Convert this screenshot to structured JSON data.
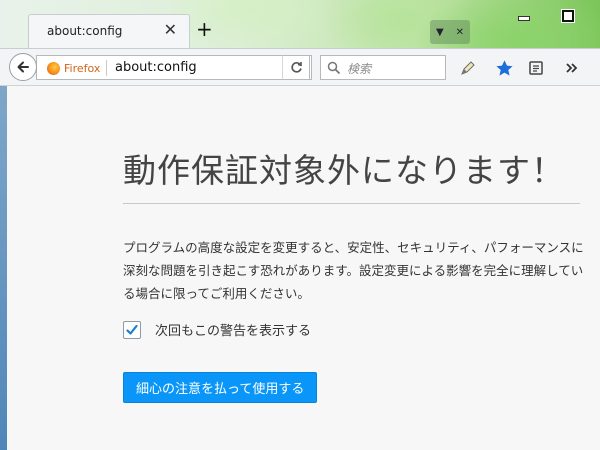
{
  "tab": {
    "title": "about:config",
    "close_glyph": "✕",
    "new_tab_glyph": "+"
  },
  "window_controls": [
    "minimize-icon",
    "maximize-icon"
  ],
  "navbar": {
    "identity_label": "Firefox",
    "url": "about:config",
    "search_placeholder": "検索",
    "icons": [
      "back-arrow-icon",
      "firefox-logo-icon",
      "reload-icon",
      "search-icon",
      "pencil-icon",
      "bookmark-star-icon",
      "reading-list-icon",
      "overflow-chevron-icon"
    ]
  },
  "page": {
    "title": "動作保証対象外になります！",
    "warning_text": "プログラムの高度な設定を変更すると、安定性、セキュリティ、パフォーマンスに深刻な問題を引き起こす恐れがあります。設定変更による影響を完全に理解している場合に限ってご利用ください。",
    "checkbox_label": "次回もこの警告を表示する",
    "checkbox_checked": true,
    "accept_button": "細心の注意を払って使用する"
  },
  "colors": {
    "accent": "#0996f8",
    "bookmark_star": "#1b6fd9",
    "firefox_orange": "#f68d1e"
  }
}
